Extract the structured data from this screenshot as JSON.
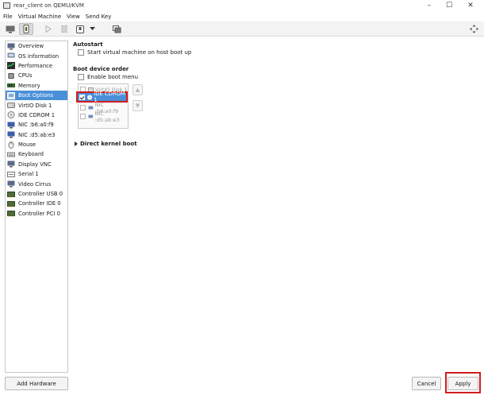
{
  "window": {
    "title": "rear_client on QEMU/KVM",
    "controls": [
      "–",
      "☐",
      "✕"
    ]
  },
  "menubar": [
    "File",
    "Virtual Machine",
    "View",
    "Send Key"
  ],
  "toolbar": {
    "icons": [
      "monitor-icon",
      "info-icon",
      "play-icon",
      "pause-icon",
      "power-icon",
      "dropdown-icon",
      "snapshot-icon",
      "fullscreen-icon"
    ],
    "active": "info-icon"
  },
  "sidebar": {
    "selected": "Boot Options",
    "items": [
      {
        "label": "Overview",
        "icon": "overview-icon"
      },
      {
        "label": "OS information",
        "icon": "os-info-icon"
      },
      {
        "label": "Performance",
        "icon": "performance-icon"
      },
      {
        "label": "CPUs",
        "icon": "cpu-icon"
      },
      {
        "label": "Memory",
        "icon": "memory-icon"
      },
      {
        "label": "Boot Options",
        "icon": "boot-options-icon"
      },
      {
        "label": "VirtIO Disk 1",
        "icon": "disk-icon"
      },
      {
        "label": "IDE CDROM 1",
        "icon": "cdrom-icon"
      },
      {
        "label": "NIC :b6:a0:f9",
        "icon": "nic-icon"
      },
      {
        "label": "NIC :d5:ab:e3",
        "icon": "nic-icon"
      },
      {
        "label": "Mouse",
        "icon": "mouse-icon"
      },
      {
        "label": "Keyboard",
        "icon": "keyboard-icon"
      },
      {
        "label": "Display VNC",
        "icon": "display-icon"
      },
      {
        "label": "Serial 1",
        "icon": "serial-icon"
      },
      {
        "label": "Video Cirrus",
        "icon": "video-icon"
      },
      {
        "label": "Controller USB 0",
        "icon": "controller-icon"
      },
      {
        "label": "Controller IDE 0",
        "icon": "controller-icon"
      },
      {
        "label": "Controller PCI 0",
        "icon": "controller-icon"
      }
    ],
    "add_hardware_label": "Add Hardware"
  },
  "autostart": {
    "heading": "Autostart",
    "checkbox_label": "Start virtual machine on host boot up",
    "checked": false
  },
  "boot": {
    "heading": "Boot device order",
    "enable_menu_label": "Enable boot menu",
    "enable_menu_checked": false,
    "devices": [
      {
        "label": "VirtIO Disk 1",
        "checked": false,
        "selected": false
      },
      {
        "label": "IDE CDROM 1",
        "checked": true,
        "selected": true
      },
      {
        "label": "NIC :b6:a0:f9",
        "checked": false,
        "selected": false
      },
      {
        "label": "NIC :d5:ab:e3",
        "checked": false,
        "selected": false
      }
    ],
    "move_up_symbol": "▲",
    "move_down_symbol": "▼"
  },
  "direct_kernel": {
    "label": "Direct kernel boot"
  },
  "footer": {
    "cancel_label": "Cancel",
    "apply_label": "Apply"
  },
  "colors": {
    "selection": "#4a90d9",
    "highlight": "#d01d1d"
  }
}
